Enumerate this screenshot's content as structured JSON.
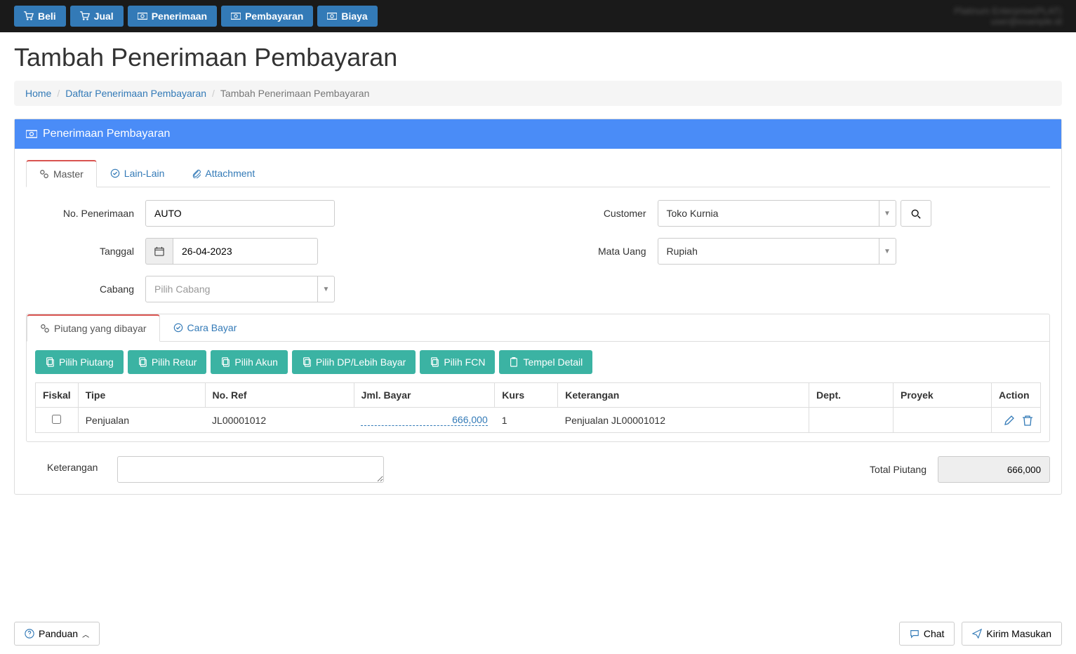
{
  "topbar": {
    "buttons": {
      "beli": "Beli",
      "jual": "Jual",
      "penerimaan": "Penerimaan",
      "pembayaran": "Pembayaran",
      "biaya": "Biaya"
    },
    "user_line1": "Platinum Enterprise(PLAT)",
    "user_line2": "user@example.id"
  },
  "page_title": "Tambah Penerimaan Pembayaran",
  "breadcrumb": {
    "home": "Home",
    "list": "Daftar Penerimaan Pembayaran",
    "current": "Tambah Penerimaan Pembayaran"
  },
  "panel_title": "Penerimaan Pembayaran",
  "tabs_main": {
    "master": "Master",
    "lain": "Lain-Lain",
    "attachment": "Attachment"
  },
  "form": {
    "no_penerimaan_label": "No. Penerimaan",
    "no_penerimaan_value": "AUTO",
    "tanggal_label": "Tanggal",
    "tanggal_value": "26-04-2023",
    "cabang_label": "Cabang",
    "cabang_placeholder": "Pilih Cabang",
    "customer_label": "Customer",
    "customer_value": "Toko Kurnia",
    "mata_uang_label": "Mata Uang",
    "mata_uang_value": "Rupiah"
  },
  "tabs_sub": {
    "piutang": "Piutang yang dibayar",
    "cara_bayar": "Cara Bayar"
  },
  "action_buttons": {
    "pilih_piutang": "Pilih Piutang",
    "pilih_retur": "Pilih Retur",
    "pilih_akun": "Pilih Akun",
    "pilih_dp": "Pilih DP/Lebih Bayar",
    "pilih_fcn": "Pilih FCN",
    "tempel_detail": "Tempel Detail"
  },
  "table": {
    "headers": {
      "fiskal": "Fiskal",
      "tipe": "Tipe",
      "no_ref": "No. Ref",
      "jml_bayar": "Jml. Bayar",
      "kurs": "Kurs",
      "keterangan": "Keterangan",
      "dept": "Dept.",
      "proyek": "Proyek",
      "action": "Action"
    },
    "rows": [
      {
        "tipe": "Penjualan",
        "no_ref": "JL00001012",
        "jml_bayar": "666,000",
        "kurs": "1",
        "keterangan": "Penjualan JL00001012",
        "dept": "",
        "proyek": ""
      }
    ]
  },
  "bottom": {
    "keterangan_label": "Keterangan",
    "total_piutang_label": "Total Piutang",
    "total_piutang_value": "666,000"
  },
  "footer": {
    "panduan": "Panduan",
    "chat": "Chat",
    "kirim_masukan": "Kirim Masukan"
  }
}
